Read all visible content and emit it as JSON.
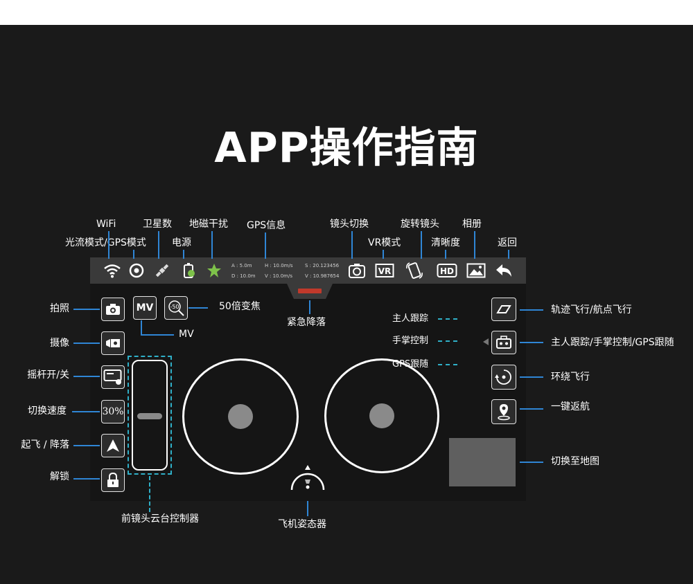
{
  "page": {
    "title": "APP操作指南",
    "colors": {
      "background": "#1a1a1a",
      "accent": "#2f86d6",
      "dashed": "#2fb0c8",
      "emergency": "#c0392b"
    }
  },
  "callouts": {
    "wifi": "WiFi",
    "flow_mode": "光流模式/GPS模式",
    "satellites": "卫星数",
    "power": "电源",
    "geomagnetic": "地磁干扰",
    "gps_info": "GPS信息",
    "lens_switch": "镜头切换",
    "vr_mode": "VR模式",
    "rotate_lens": "旋转镜头",
    "clarity": "清晰度",
    "album": "相册",
    "back": "返回",
    "photo": "拍照",
    "video": "摄像",
    "joystick_toggle": "摇杆开/关",
    "speed_switch": "切换速度",
    "takeoff_land": "起飞 / 降落",
    "unlock": "解锁",
    "zoom": "50倍变焦",
    "mv": "MV",
    "emergency_land": "紧急降落",
    "gimbal": "前镜头云台控制器",
    "attitude": "飞机姿态器",
    "track_flight": "轨迹飞行/航点飞行",
    "follow_modes": "主人跟踪/手掌控制/GPS跟随",
    "orbit": "环绕飞行",
    "return_home": "一键返航",
    "map_switch": "切换至地图"
  },
  "follow_submenu": [
    "主人跟踪",
    "手掌控制",
    "GPS跟随"
  ],
  "telemetry": {
    "a": "A : 5.0m",
    "d": "D : 10.0m",
    "h": "H : 10.0m/s",
    "v": "V : 10.0m/s",
    "s": "S : 20.123456",
    "v2": "V : 10.987654"
  },
  "buttons": {
    "mv_label": "MV",
    "zoom_label": "-50",
    "speed_label": "30%",
    "hd_label": "HD",
    "vr_label": "VR"
  },
  "icons": [
    "wifi-icon",
    "optical-flow-icon",
    "satellite-icon",
    "battery-icon",
    "geomagnetic-icon",
    "lens-switch-icon",
    "vr-icon",
    "rotate-lens-icon",
    "hd-icon",
    "album-icon",
    "back-icon",
    "camera-icon",
    "video-icon",
    "joystick-toggle-icon",
    "takeoff-icon",
    "lock-icon",
    "track-flight-icon",
    "follow-icon",
    "orbit-icon",
    "return-home-icon"
  ]
}
